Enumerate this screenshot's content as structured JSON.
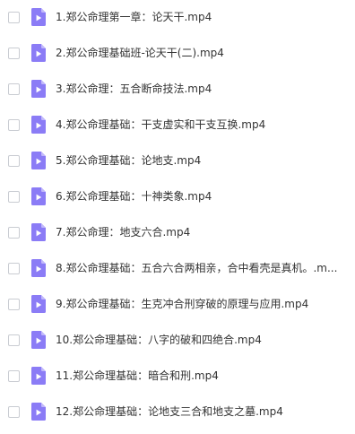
{
  "icons": {
    "file_icon": "video-file-icon",
    "file_icon_color": "#8b7cf6",
    "file_icon_fold_color": "#c2b9fb"
  },
  "files": [
    {
      "name": "1.郑公命理第一章：论天干.mp4"
    },
    {
      "name": "2.郑公命理基础班-论天干(二).mp4"
    },
    {
      "name": "3.郑公命理：五合断命技法.mp4"
    },
    {
      "name": "4.郑公命理基础：干支虚实和干支互换.mp4"
    },
    {
      "name": "5.郑公命理基础：论地支.mp4"
    },
    {
      "name": "6.郑公命理基础：十神类象.mp4"
    },
    {
      "name": "7.郑公命理：地支六合.mp4"
    },
    {
      "name": "8.郑公命理基础：五合六合两相亲，合中看壳是真机。.m..."
    },
    {
      "name": "9.郑公命理基础：生克冲合刑穿破的原理与应用.mp4"
    },
    {
      "name": "10.郑公命理基础：八字的破和四绝合.mp4"
    },
    {
      "name": "11.郑公命理基础：暗合和刑.mp4"
    },
    {
      "name": "12.郑公命理基础：论地支三合和地支之墓.mp4"
    }
  ]
}
